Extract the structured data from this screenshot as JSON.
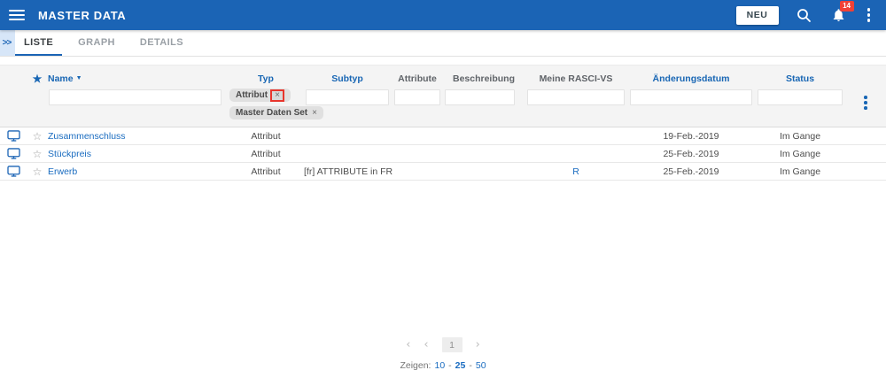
{
  "app_bar": {
    "title": "MASTER DATA",
    "neu_button_label": "NEU",
    "notification_count": "14"
  },
  "tab_bar": {
    "expand_glyph": ">>",
    "tabs": [
      {
        "label": "LISTE"
      },
      {
        "label": "GRAPH"
      },
      {
        "label": "DETAILS"
      }
    ],
    "active_tab": "LISTE"
  },
  "table": {
    "header": {
      "star_glyph": "★",
      "columns": [
        {
          "label": "Name",
          "sort_indicator": "▼"
        },
        {
          "label": "Typ"
        },
        {
          "label": "Subtyp"
        },
        {
          "label": "Attribute"
        },
        {
          "label": "Beschreibung"
        },
        {
          "label": "Meine RASCI-VS"
        },
        {
          "label": "Änderungsdatum"
        },
        {
          "label": "Status"
        }
      ]
    },
    "filters": {
      "typ_chips": [
        {
          "label": "Attribut",
          "close_glyph": "×",
          "highlighted": true
        },
        {
          "label": "Master Daten Set",
          "close_glyph": "×",
          "highlighted": false
        }
      ]
    },
    "rows": [
      {
        "star_glyph": "☆",
        "name": "Zusammenschluss",
        "typ": "Attribut",
        "subtyp": "",
        "attribute": "",
        "beschreibung": "",
        "meine_rasci_vs": "",
        "aenderungsdatum": "19-Feb.-2019",
        "status": "Im Gange"
      },
      {
        "star_glyph": "☆",
        "name": "Stückpreis",
        "typ": "Attribut",
        "subtyp": "",
        "attribute": "",
        "beschreibung": "",
        "meine_rasci_vs": "",
        "aenderungsdatum": "25-Feb.-2019",
        "status": "Im Gange"
      },
      {
        "star_glyph": "☆",
        "name": "Erwerb",
        "typ": "Attribut",
        "subtyp": "[fr] ATTRIBUTE in FR",
        "attribute": "",
        "beschreibung": "",
        "meine_rasci_vs": "R",
        "aenderungsdatum": "25-Feb.-2019",
        "status": "Im Gange"
      }
    ]
  },
  "pagination": {
    "first_glyph": "‹",
    "prev_glyph": "‹",
    "current_page": "1",
    "next_glyph": "›",
    "page_size": {
      "label": "Zeigen:",
      "separator": "-",
      "options": [
        "10",
        "25",
        "50"
      ],
      "selected": "25"
    }
  },
  "colors": {
    "app_bar_blue": "#1b64b5",
    "column_header_blue": "#1866b4",
    "link_blue": "#1a6cc0",
    "badge_red": "#ef4136",
    "highlight_red": "#e8352c",
    "chip_gray": "#e0e0e0",
    "filter_band_gray": "#f4f4f4"
  }
}
